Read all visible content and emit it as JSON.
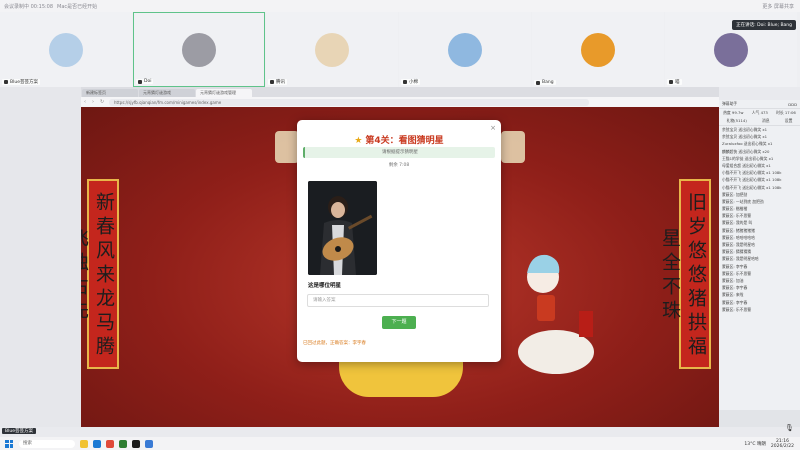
{
  "topbar": {
    "left": "会议录制中  00:15:08",
    "app_name": "Mac是否已经开始",
    "right": "更多  屏幕共享"
  },
  "speaker_label": "正在讲话: Doi: Blue; Bang",
  "participants": [
    {
      "name": "Blue芸芸方案",
      "color": "#b5cfe8"
    },
    {
      "name": "Doi",
      "color": "#9c9ca4"
    },
    {
      "name": "腾讯",
      "color": "#e8d5b6"
    },
    {
      "name": "小棉",
      "color": "#8fb8e0"
    },
    {
      "name": "Bang",
      "color": "#e89a2a"
    },
    {
      "name": "喵",
      "color": "#7a6f9a"
    }
  ],
  "browser": {
    "tabs": [
      "新建标签页",
      "元宵猜灯谜游戏",
      "元宵猜灯谜游戏管理"
    ],
    "url": "https://sjyfb.qianqian/fm.com/minigames/index.game"
  },
  "game": {
    "couplet_left": "新春风来龙马腾飞独占先",
    "couplet_right": "旧岁悠悠猪拱福星全不珠"
  },
  "modal": {
    "title": "第4关：看图猜明星",
    "progress": "请根据提示猜明星",
    "timer": "剩余 7:08",
    "question": "这是哪位明星",
    "placeholder": "请输入答案",
    "next_button": "下一题",
    "status": "已回过此题，正确答案：李宇春"
  },
  "chat": {
    "header": "弹幕助手",
    "header_right": "DDD",
    "stats": [
      "热度 99.7w",
      "人气 473",
      "时长 17:06"
    ],
    "tabs": [
      "礼物(5114)",
      "消息",
      "设置"
    ],
    "messages": [
      "余弦宝贝 送出初心微笑 x1",
      "余弦宝贝 送出初心微笑 x1",
      "Zuraluxfoo 送出初心微笑 x1",
      "麟麟超快 送出初心微笑 x20",
      "王猫1的学徒 送出初心微笑 x1",
      "母爱组合超 送出初心微笑 x1",
      "小猫不开飞 送出初心微笑 x1 108k",
      "小猫不开飞 送出初心微笑 x1 108k",
      "小猫不开飞 送出初心微笑 x1 108k",
      "蒙蔽区: 加把劲",
      "蒙蔽区: 一站到底 加把劲",
      "蒙蔽区: 楷楷楷",
      "蒙蔽区: 乐不思蜀",
      "蒙蔽区: 我的是 叫",
      "蒙蔽区: 猪猪猪猪猪",
      "蒙蔽区: 哈哈哈哈哈",
      "蒙蔽区: 我是明星哈",
      "蒙蔽区: 猜猜猜猜",
      "蒙蔽区: 我是明星哈哈",
      "蒙蔽区: 李宇春",
      "蒙蔽区: 乐不思蜀",
      "蒙蔽区: 加油",
      "蒙蔽区: 李宇春",
      "蒙蔽区: 来啦",
      "蒙蔽区: 李宇春",
      "蒙蔽区: 乐不思蜀"
    ]
  },
  "self_name": "Blue芸芸方案",
  "taskbar": {
    "search": "搜索",
    "weather": "13°C 晴朗",
    "time": "21:16",
    "date": "2026/2/22"
  },
  "colors": {
    "accent_green": "#4caf50",
    "title_red": "#c93a20",
    "status_orange": "#d97a1c"
  }
}
